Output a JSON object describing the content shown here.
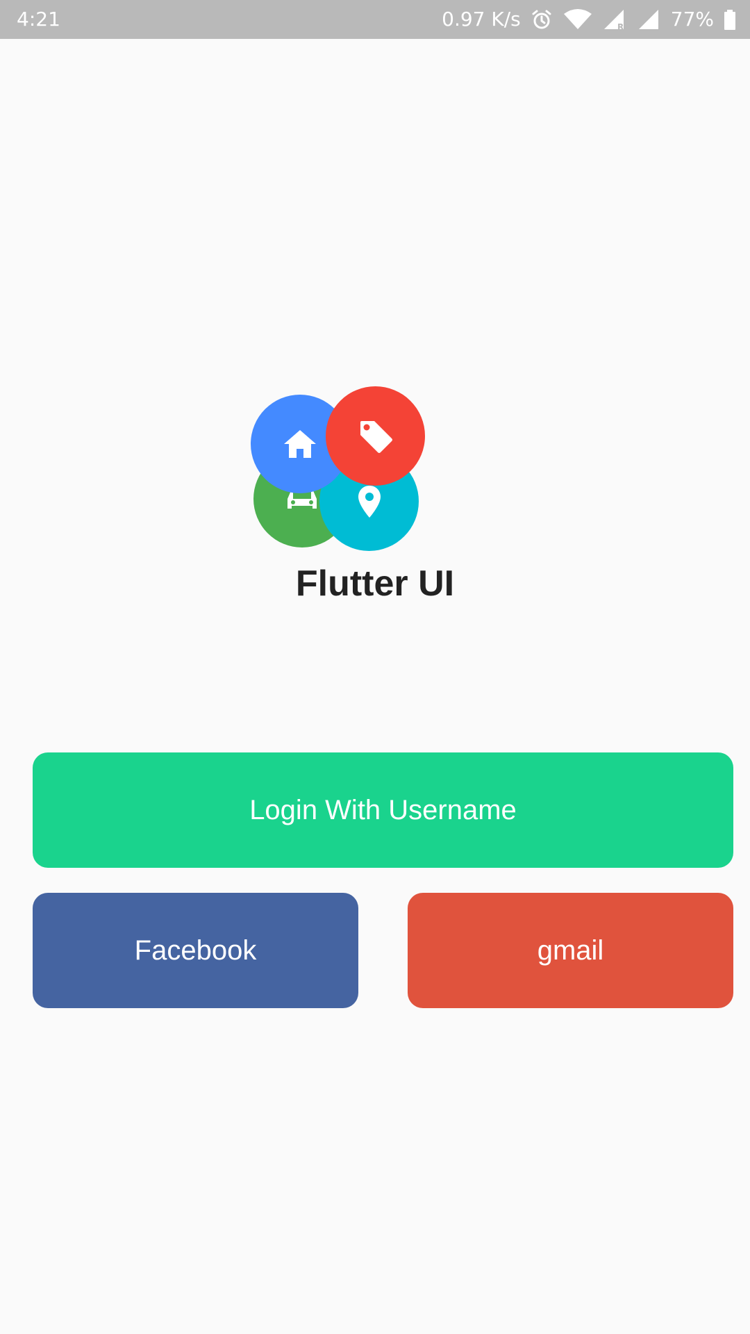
{
  "status_bar": {
    "time": "4:21",
    "network_speed": "0.97 K/s",
    "battery_percent": "77%",
    "icons": [
      "alarm-icon",
      "wifi-icon",
      "signal-roaming-icon",
      "signal-icon",
      "battery-icon"
    ],
    "background_color": "#b9b9b9"
  },
  "logo": {
    "circles": [
      {
        "name": "home",
        "icon": "home-icon",
        "color": "#448aff"
      },
      {
        "name": "tag",
        "icon": "tag-icon",
        "color": "#f44336"
      },
      {
        "name": "car",
        "icon": "car-icon",
        "color": "#4caf50"
      },
      {
        "name": "location",
        "icon": "location-pin-icon",
        "color": "#00bcd4"
      }
    ]
  },
  "app_title": "Flutter UI",
  "buttons": {
    "login_label": "Login With Username",
    "login_color": "#1ad38d",
    "facebook_label": "Facebook",
    "facebook_color": "#4564a1",
    "gmail_label": "gmail",
    "gmail_color": "#e0533d"
  }
}
